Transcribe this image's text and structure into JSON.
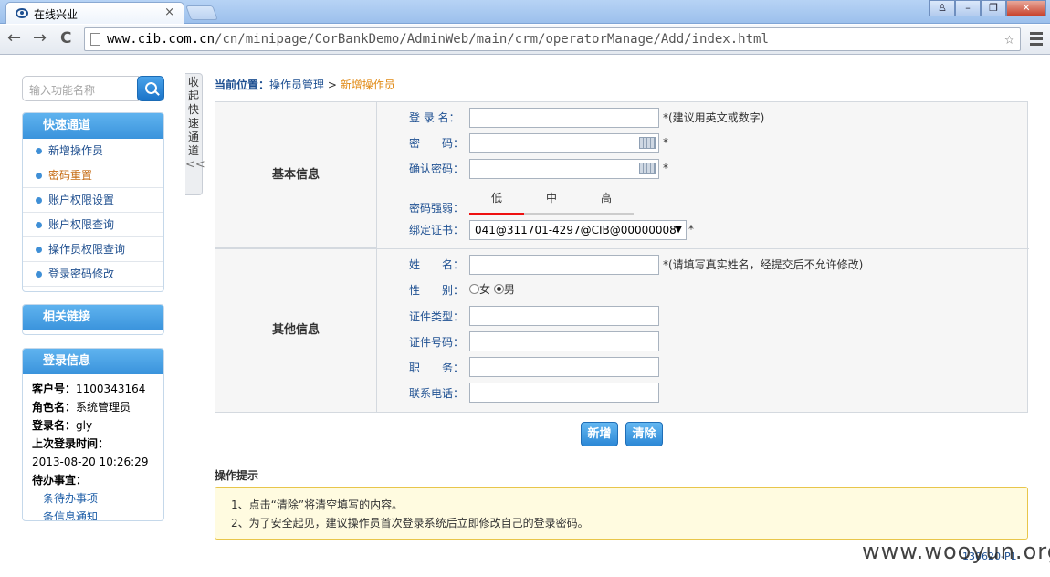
{
  "browser": {
    "tab_title": "在线兴业",
    "tab_close": "×",
    "url_host": "www.cib.com.cn",
    "url_path": "/cn/minipage/CorBankDemo/AdminWeb/main/crm/operatorManage/Add/index.html",
    "back": "←",
    "forward": "→",
    "reload": "C",
    "star": "☆",
    "win_user": "♙",
    "win_min": "–",
    "win_max": "❐",
    "win_close": "✕"
  },
  "sidebar": {
    "search_placeholder": "输入功能名称",
    "quick": {
      "title": "快速通道",
      "items": [
        {
          "label": "新增操作员"
        },
        {
          "label": "密码重置"
        },
        {
          "label": "账户权限设置"
        },
        {
          "label": "账户权限查询"
        },
        {
          "label": "操作员权限查询"
        },
        {
          "label": "登录密码修改"
        }
      ]
    },
    "links_title": "相关链接",
    "login": {
      "title": "登录信息",
      "customer_label": "客户号：",
      "customer_value": "1100343164",
      "role_label": "角色名：",
      "role_value": "系统管理员",
      "login_name_label": "登录名：",
      "login_name_value": "gly",
      "last_login_label": "上次登录时间：",
      "last_login_value": "2013-08-20 10:26:29",
      "todo_label": "待办事宜：",
      "todo_items": [
        "条待办事项",
        "条信息通知"
      ]
    }
  },
  "collapse": {
    "label": "收起快速通道",
    "arrow": "<<"
  },
  "breadcrumb": {
    "label": "当前位置：",
    "item1": "操作员管理",
    "sep": " > ",
    "item2": "新增操作员"
  },
  "form": {
    "basic_title": "基本信息",
    "other_title": "其他信息",
    "login_name_label": "登 录 名：",
    "login_name_hint": "*(建议用英文或数字)",
    "password_label": "密　　码：",
    "confirm_label": "确认密码：",
    "required": "*",
    "strength_label": "密码强弱：",
    "strength_levels": [
      "低",
      "中",
      "高"
    ],
    "cert_label": "绑定证书：",
    "cert_value": "041@311701-4297@CIB@00000008",
    "name_label": "姓　　名：",
    "name_hint": "*(请填写真实姓名，经提交后不允许修改)",
    "gender_label": "性　　别：",
    "gender_female": "女",
    "gender_male": "男",
    "id_type_label": "证件类型：",
    "id_no_label": "证件号码：",
    "position_label": "职　　务：",
    "phone_label": "联系电话："
  },
  "buttons": {
    "add": "新增",
    "clear": "清除"
  },
  "tips": {
    "title": "操作提示",
    "lines": [
      "1、点击“清除”将清空填写的内容。",
      "2、为了安全起见，建议操作员首次登录系统后立即修改自己的登录密码。"
    ]
  },
  "footer": {
    "version": "130620-P1",
    "watermark": "www.wooyun.org"
  }
}
